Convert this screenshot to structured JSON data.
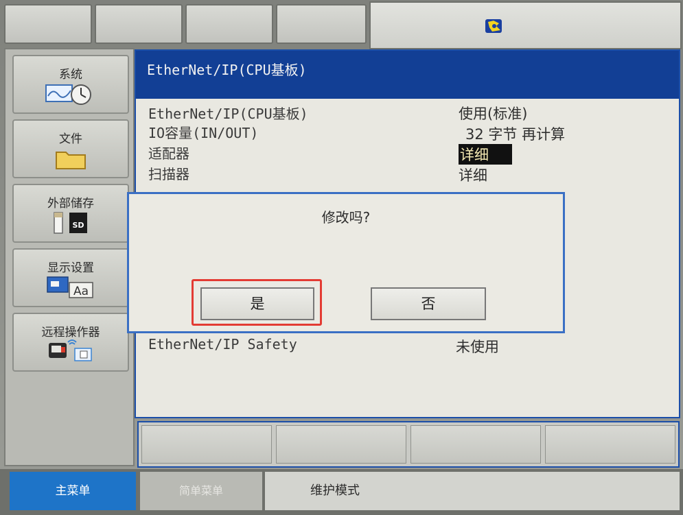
{
  "window": {
    "title": "EtherNet/IP(CPU基板)"
  },
  "sidebar": {
    "items": [
      {
        "label": "系统",
        "icon": "system-clock-icon"
      },
      {
        "label": "文件",
        "icon": "folder-icon"
      },
      {
        "label": "外部储存",
        "icon": "sd-card-icon"
      },
      {
        "label": "显示设置",
        "icon": "display-font-icon"
      },
      {
        "label": "远程操作器",
        "icon": "remote-operator-icon"
      }
    ]
  },
  "settings": {
    "rows": [
      {
        "label": "EtherNet/IP(CPU基板)",
        "value": "使用(标准)"
      },
      {
        "label": "IO容量(IN/OUT)",
        "value": "32 字节 再计算"
      },
      {
        "label": "适配器",
        "value": "详细"
      },
      {
        "label": "扫描器",
        "value": "详细"
      },
      {
        "label": "EtherNet/IP Safety",
        "value": "未使用"
      }
    ]
  },
  "dialog": {
    "question": "修改吗?",
    "yes_label": "是",
    "no_label": "否"
  },
  "nav": {
    "main_menu": "主菜单",
    "simple_menu": "简单菜单",
    "maintenance_mode": "维护模式"
  },
  "colors": {
    "title_bar": "#123f95",
    "main_menu_active": "#1e74c8",
    "highlight_box": "#e33b33",
    "selected_value_bg": "#111111"
  }
}
